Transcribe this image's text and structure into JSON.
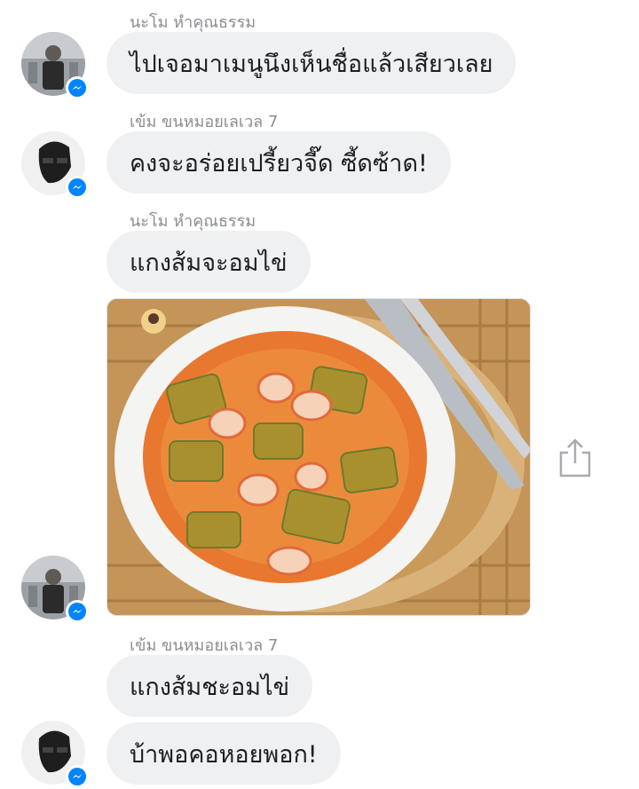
{
  "messages": [
    {
      "sender": "นะโม หำคุณธรรม",
      "text": "ไปเจอมาเมนูนึงเห็นชื่อแล้วเสียวเลย"
    },
    {
      "sender": "เข้ม ขนหมอยเลเวล 7",
      "text": "คงจะอร่อยเปรี้ยวจี๊ด ซี้ดซ้าด!"
    },
    {
      "sender": "นะโม หำคุณธรรม",
      "text": "แกงส้มจะอมไข่"
    },
    {
      "sender": "เข้ม ขนหมอยเลเวล 7",
      "text": "แกงส้มชะอมไข่"
    },
    {
      "sender": "",
      "text": "บ้าพอคอหอยพอก!"
    }
  ],
  "photo": {
    "icon": "curry-bowl-photo"
  },
  "icons": {
    "messenger_badge": "messenger-icon",
    "share": "share-icon"
  },
  "colors": {
    "bubble": "#eef0f2",
    "sender": "#8a8d91",
    "text": "#1c1e21",
    "messenger": "#0084ff"
  }
}
